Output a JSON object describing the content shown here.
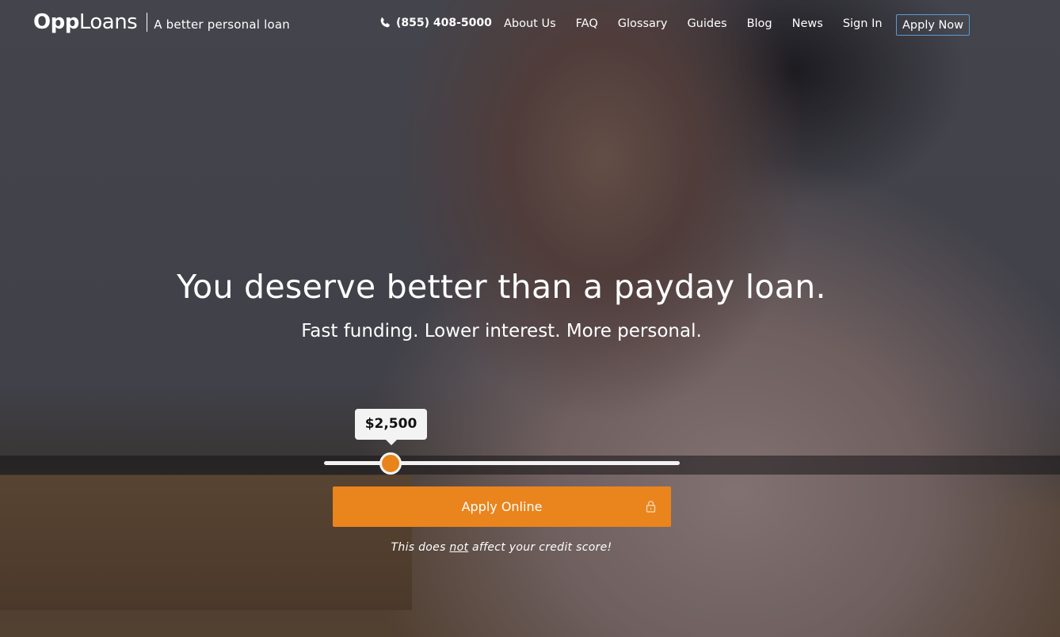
{
  "brand": {
    "logo_part1": "Opp",
    "logo_part2": "Loans",
    "tagline": "A better personal loan"
  },
  "header": {
    "phone": "(855) 408-5000",
    "nav": [
      "About Us",
      "FAQ",
      "Glossary",
      "Guides",
      "Blog",
      "News",
      "Sign In"
    ],
    "apply_now": "Apply Now"
  },
  "hero": {
    "headline": "You deserve better than a payday loan.",
    "subheadline": "Fast funding. Lower interest. More personal."
  },
  "loan_slider": {
    "amount_label": "$2,500",
    "position_fraction": 0.19
  },
  "cta": {
    "label": "Apply Online",
    "disclaimer_before": "This does ",
    "disclaimer_emphasis": "not",
    "disclaimer_after": " affect your credit score!"
  },
  "colors": {
    "accent": "#ea841d",
    "apply_now_border": "#5b9bd5"
  },
  "icons": {
    "phone": "phone-icon",
    "lock": "lock-icon"
  }
}
